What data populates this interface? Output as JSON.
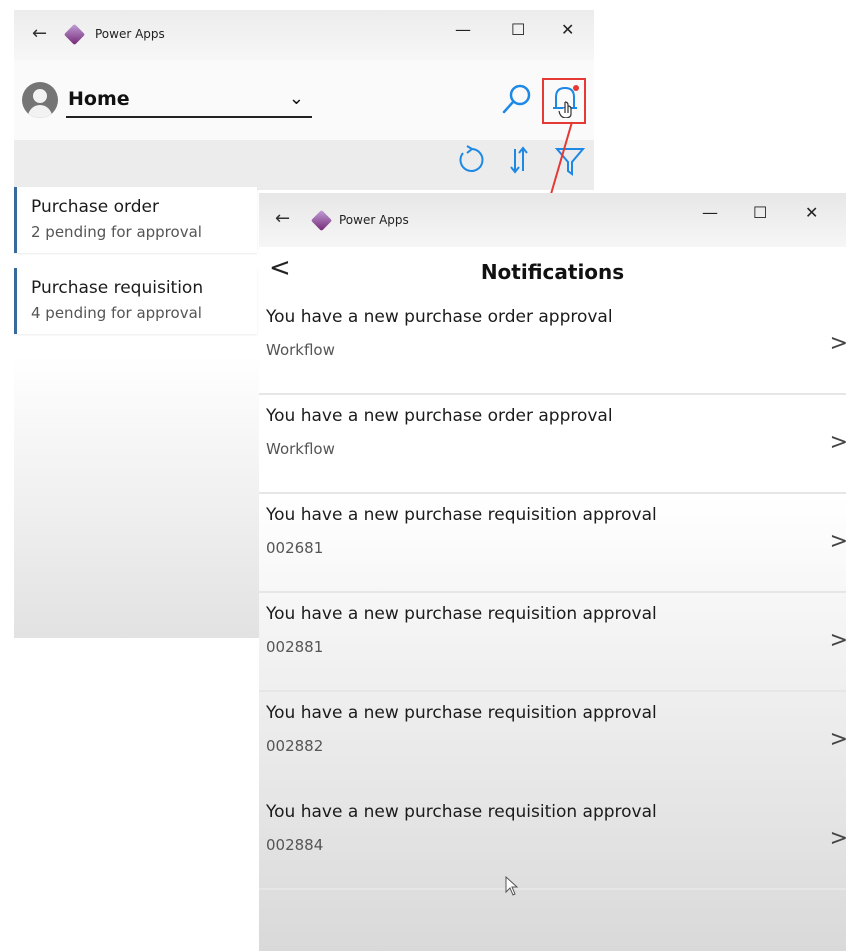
{
  "home_window": {
    "app_title": "Power Apps",
    "back_glyph": "←",
    "minimize_glyph": "—",
    "maximize_glyph": "☐",
    "close_glyph": "✕",
    "header": {
      "selector_label": "Home",
      "dropdown_glyph": "⌄"
    },
    "icons": [
      "search-icon",
      "notifications-bell-icon",
      "refresh-icon",
      "sort-icon",
      "filter-icon"
    ],
    "cards": [
      {
        "title": "Purchase order",
        "subtitle": "2 pending for approval"
      },
      {
        "title": "Purchase requisition",
        "subtitle": "4 pending for approval"
      }
    ]
  },
  "notifications_window": {
    "app_title": "Power Apps",
    "back_glyph": "←",
    "minimize_glyph": "—",
    "maximize_glyph": "☐",
    "close_glyph": "✕",
    "header": {
      "back_glyph": "<",
      "title": "Notifications"
    },
    "items": [
      {
        "title": "You have a new purchase order approval",
        "subtitle": "Workflow",
        "chevron": ">"
      },
      {
        "title": "You have a new purchase order approval",
        "subtitle": "Workflow",
        "chevron": ">"
      },
      {
        "title": "You have a new purchase requisition approval",
        "subtitle": "002681",
        "chevron": ">"
      },
      {
        "title": "You have a new purchase requisition approval",
        "subtitle": "002881",
        "chevron": ">"
      },
      {
        "title": "You have a new purchase requisition approval",
        "subtitle": "002882",
        "chevron": ">"
      },
      {
        "title": "You have a new purchase requisition approval",
        "subtitle": "002884",
        "chevron": ">"
      }
    ]
  },
  "colors": {
    "accent": "#1e88e5",
    "highlight": "#e53935",
    "card_bar": "#3a6a9c",
    "logo": "#742774"
  }
}
